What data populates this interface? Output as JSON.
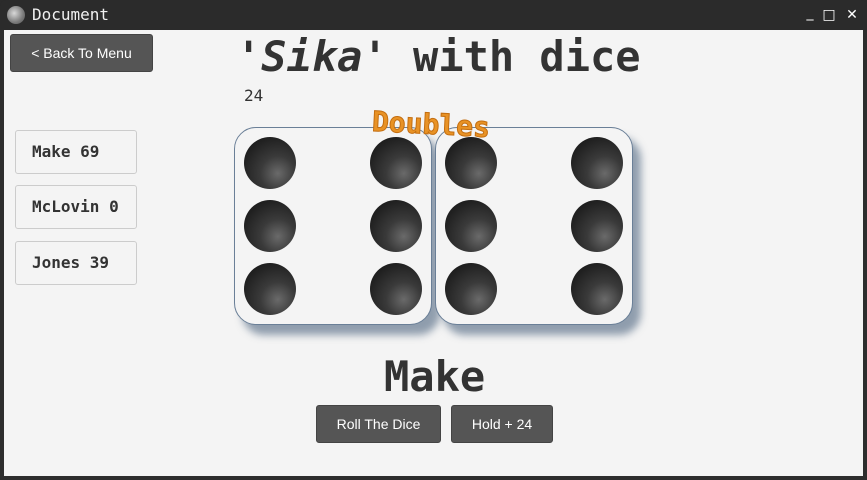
{
  "window": {
    "title": "Document",
    "minimize": "_",
    "maximize": "□",
    "close": "✕"
  },
  "nav": {
    "back_label": "< Back To Menu"
  },
  "game": {
    "title_quote_name": "'Sika'",
    "title_rest": " with dice",
    "current_score": "24",
    "doubles_label": "Doubles",
    "current_player": "Make",
    "dice": [
      6,
      6
    ]
  },
  "players": [
    {
      "label": "Make 69"
    },
    {
      "label": "McLovin 0"
    },
    {
      "label": "Jones 39"
    }
  ],
  "actions": {
    "roll_label": "Roll The Dice",
    "hold_label": "Hold + 24"
  }
}
